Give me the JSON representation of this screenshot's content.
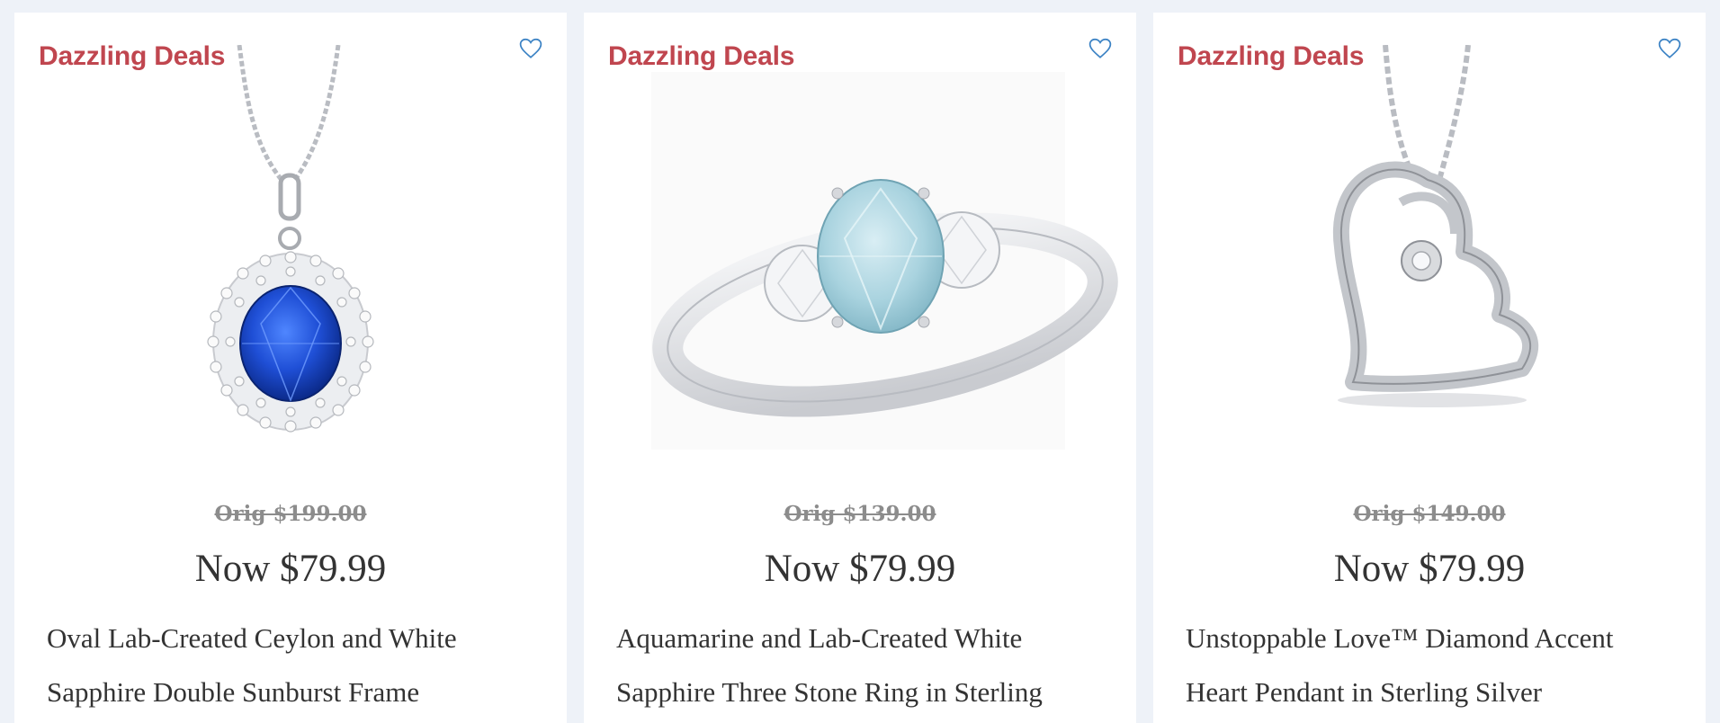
{
  "products": [
    {
      "badge": "Dazzling Deals",
      "wishlist_icon": "heart-outline-icon",
      "image": "oval-blue-sapphire-pendant",
      "orig_price": "Orig $199.00",
      "now_price": "Now $79.99",
      "title": "Oval Lab-Created Ceylon and White Sapphire Double Sunburst Frame"
    },
    {
      "badge": "Dazzling Deals",
      "wishlist_icon": "heart-outline-icon",
      "image": "aquamarine-three-stone-ring",
      "orig_price": "Orig $139.00",
      "now_price": "Now $79.99",
      "title": "Aquamarine and Lab-Created White Sapphire Three Stone Ring in Sterling"
    },
    {
      "badge": "Dazzling Deals",
      "wishlist_icon": "heart-outline-icon",
      "image": "heart-pendant-sterling-silver",
      "orig_price": "Orig $149.00",
      "now_price": "Now $79.99",
      "title": "Unstoppable Love™ Diamond Accent Heart Pendant in Sterling Silver"
    }
  ],
  "colors": {
    "badge": "#c0464f",
    "heart_icon": "#3b82c4",
    "page_bg": "#eef2f8",
    "card_bg": "#ffffff",
    "orig_price": "#8c8c8c",
    "text": "#333333"
  }
}
